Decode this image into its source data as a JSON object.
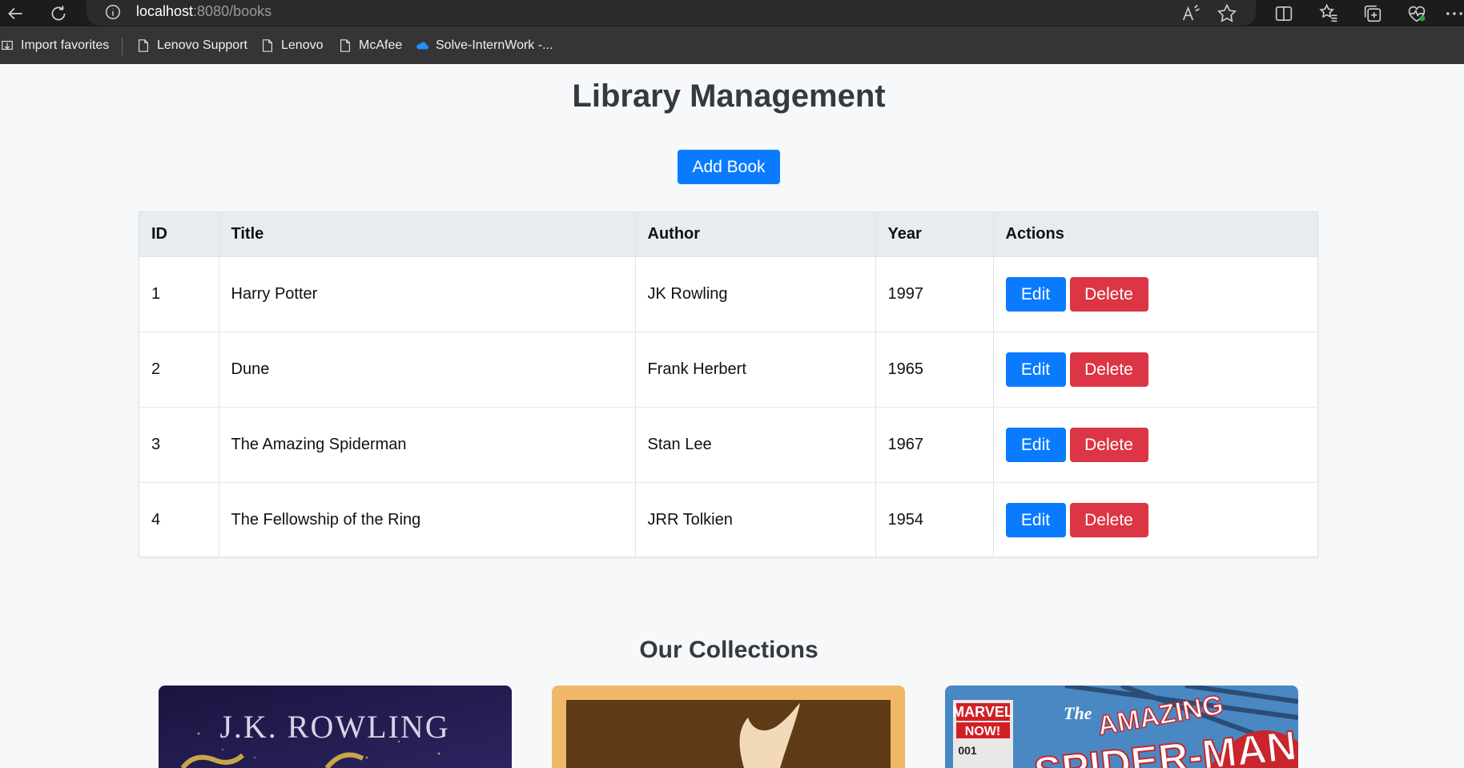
{
  "browser": {
    "url_host": "localhost",
    "url_path": ":8080/books",
    "bookmarks": [
      "Import favorites",
      "Lenovo Support",
      "Lenovo",
      "McAfee",
      "Solve-InternWork -..."
    ]
  },
  "page": {
    "title": "Library Management",
    "add_button": "Add Book"
  },
  "table": {
    "headers": [
      "ID",
      "Title",
      "Author",
      "Year",
      "Actions"
    ],
    "rows": [
      {
        "id": "1",
        "title": "Harry Potter",
        "author": "JK Rowling",
        "year": "1997"
      },
      {
        "id": "2",
        "title": "Dune",
        "author": "Frank Herbert",
        "year": "1965"
      },
      {
        "id": "3",
        "title": "The Amazing Spiderman",
        "author": "Stan Lee",
        "year": "1967"
      },
      {
        "id": "4",
        "title": "The Fellowship of the Ring",
        "author": "JRR Tolkien",
        "year": "1954"
      }
    ],
    "edit_label": "Edit",
    "delete_label": "Delete"
  },
  "collections": {
    "title": "Our Collections",
    "cards": [
      {
        "cover_text": "J.K. ROWLING"
      },
      {
        "cover_text": ""
      },
      {
        "cover_text_1": "MARVEL",
        "cover_text_2": "NOW!",
        "cover_text_3": "001",
        "cover_text_4": "The",
        "cover_text_5": "AMAZING",
        "cover_text_6": "SPIDER-MAN"
      }
    ]
  },
  "colors": {
    "primary": "#0a7bff",
    "danger": "#dc3545",
    "header_bg": "#e9ecef"
  }
}
